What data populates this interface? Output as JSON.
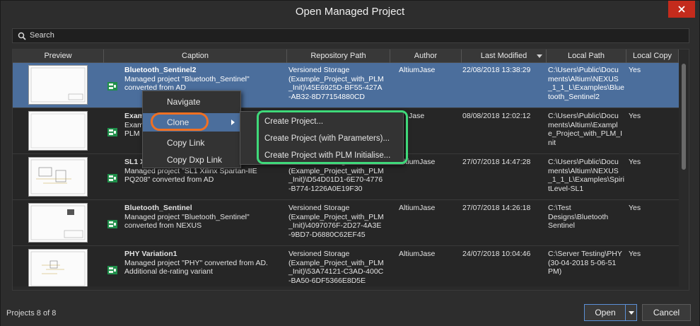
{
  "window": {
    "title": "Open Managed Project",
    "close_icon": "close-icon"
  },
  "search": {
    "label": "Search",
    "icon": "search-icon"
  },
  "columns": [
    "Preview",
    "Caption",
    "Repository Path",
    "Author",
    "Last Modified",
    "Local Path",
    "Local Copy"
  ],
  "rows": [
    {
      "title": "Bluetooth_Sentinel2",
      "desc_1": "Managed project \"Bluetooth_Sentinel\"",
      "desc_2": "converted from AD",
      "desc_3": "",
      "repo_1": "Versioned Storage",
      "repo_2": "(Example_Project_with_PLM",
      "repo_3": "_Init)\\45E6925D-BF55-427A",
      "repo_4": "-AB32-8D77154880CD",
      "author": "AltiumJase",
      "modified": "22/08/2018 13:38:29",
      "local_1": "C:\\Users\\Public\\Docu",
      "local_2": "ments\\Altium\\NEXUS",
      "local_3": "_1_1_L\\Examples\\Blue",
      "local_4": "tooth_Sentinel2",
      "local_copy": "Yes",
      "selected": true
    },
    {
      "title": "Exam",
      "desc_1": "Examp",
      "desc_2": "PLM",
      "desc_3": "",
      "repo_1": "",
      "repo_2": "",
      "repo_3": "",
      "repo_4": "",
      "author": "Jase",
      "modified": "08/08/2018 12:02:12",
      "local_1": "C:\\Users\\Public\\Docu",
      "local_2": "ments\\Altium\\Exampl",
      "local_3": "e_Project_with_PLM_I",
      "local_4": "nit",
      "local_copy": "Yes",
      "selected": false
    },
    {
      "title": "SL1 X",
      "desc_1": "Managed project \"SL1 Xilinx Spartan-IIE",
      "desc_2": "PQ208\" converted from AD",
      "desc_3": "",
      "repo_1": "Versioned Storage",
      "repo_2": "(Example_Project_with_PLM",
      "repo_3": "_Init)\\D54D01D1-6E70-4776",
      "repo_4": "-B774-1226A0E19F30",
      "author": "AltiumJase",
      "modified": "27/07/2018 14:47:28",
      "local_1": "C:\\Users\\Public\\Docu",
      "local_2": "ments\\Altium\\NEXUS",
      "local_3": "_1_1_L\\Examples\\Spiri",
      "local_4": "tLevel-SL1",
      "local_copy": "Yes",
      "selected": false
    },
    {
      "title": "Bluetooth_Sentinel",
      "desc_1": "Managed project \"Bluetooth_Sentinel\"",
      "desc_2": "converted from NEXUS",
      "desc_3": "",
      "repo_1": "Versioned Storage",
      "repo_2": "(Example_Project_with_PLM",
      "repo_3": "_Init)\\4097076F-2D27-4A3E",
      "repo_4": "-9BD7-D6880C62EF45",
      "author": "AltiumJase",
      "modified": "27/07/2018 14:26:18",
      "local_1": "C:\\Test",
      "local_2": "Designs\\Bluetooth",
      "local_3": "Sentinel",
      "local_4": "",
      "local_copy": "Yes",
      "selected": false
    },
    {
      "title": "PHY Variation1",
      "desc_1": "Managed project \"PHY\" converted from AD.",
      "desc_2": "Additional de-rating variant",
      "desc_3": "",
      "repo_1": "Versioned Storage",
      "repo_2": "(Example_Project_with_PLM",
      "repo_3": "_Init)\\53A74121-C3AD-400C",
      "repo_4": "-BA50-6DF5366E8D5E",
      "author": "AltiumJase",
      "modified": "24/07/2018 10:04:46",
      "local_1": "C:\\Server Testing\\PHY",
      "local_2": "(30-04-2018 5-06-51",
      "local_3": "PM)",
      "local_4": "",
      "local_copy": "Yes",
      "selected": false
    }
  ],
  "context_menu": {
    "items": [
      "Navigate",
      "Clone",
      "Copy Link",
      "Copy Dxp Link"
    ],
    "active": "Clone"
  },
  "clone_submenu": {
    "items": [
      "Create Project...",
      "Create Project (with Parameters)...",
      "Create Project with PLM Initialise..."
    ]
  },
  "footer": {
    "status": "Projects 8 of 8",
    "open_label": "Open",
    "cancel_label": "Cancel"
  },
  "colors": {
    "selection": "#4b6e9c",
    "clone_highlight": "#f07022",
    "submenu_highlight": "#3fd97a"
  }
}
